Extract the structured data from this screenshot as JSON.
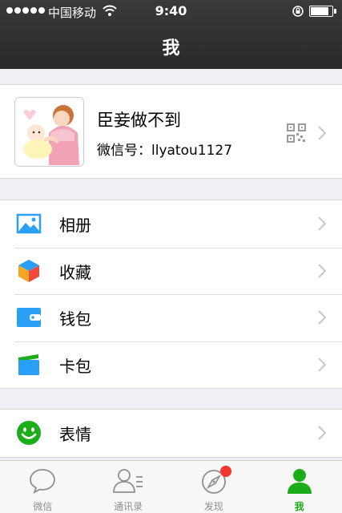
{
  "status_bar": {
    "carrier": "中国移动",
    "time": "9:40"
  },
  "nav": {
    "title": "我"
  },
  "profile": {
    "nickname": "臣妾做不到",
    "wechat_id": "微信号：llyatou1127"
  },
  "menu_sections": [
    [
      {
        "label": "相册",
        "icon": "album-icon",
        "color": "#2a9ff6"
      },
      {
        "label": "收藏",
        "icon": "favorites-cube-icon",
        "color": "#f5a623"
      },
      {
        "label": "钱包",
        "icon": "wallet-icon",
        "color": "#2a9ff6"
      },
      {
        "label": "卡包",
        "icon": "card-pack-icon",
        "color": "#2a9ff6"
      }
    ],
    [
      {
        "label": "表情",
        "icon": "emoji-icon",
        "color": "#1aad19"
      }
    ]
  ],
  "tabbar": {
    "tabs": [
      {
        "label": "微信",
        "icon": "chat-bubble-icon"
      },
      {
        "label": "通讯录",
        "icon": "contacts-icon"
      },
      {
        "label": "发现",
        "icon": "compass-icon"
      },
      {
        "label": "我",
        "icon": "me-person-icon"
      }
    ],
    "active": "我",
    "accent": "#1aad19",
    "badge_color": "#f43530"
  }
}
